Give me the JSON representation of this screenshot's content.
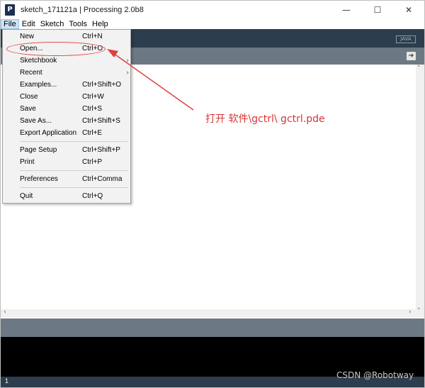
{
  "window": {
    "title": "sketch_171121a | Processing 2.0b8",
    "app_logo": "P",
    "controls": {
      "minimize": "—",
      "maximize": "☐",
      "close": "✕"
    }
  },
  "menubar": {
    "items": [
      {
        "label": "File",
        "active": true
      },
      {
        "label": "Edit"
      },
      {
        "label": "Sketch"
      },
      {
        "label": "Tools"
      },
      {
        "label": "Help"
      }
    ]
  },
  "toolbar": {
    "mode": "JAVA"
  },
  "tabstrip": {
    "arrow": "➔"
  },
  "file_menu": {
    "items": [
      {
        "label": "New",
        "shortcut": "Ctrl+N"
      },
      {
        "label": "Open...",
        "shortcut": "Ctrl+O"
      },
      {
        "label": "Sketchbook",
        "shortcut": "",
        "submenu": "›"
      },
      {
        "label": "Recent",
        "shortcut": "",
        "submenu": "›"
      },
      {
        "label": "Examples...",
        "shortcut": "Ctrl+Shift+O"
      },
      {
        "label": "Close",
        "shortcut": "Ctrl+W"
      },
      {
        "label": "Save",
        "shortcut": "Ctrl+S"
      },
      {
        "label": "Save As...",
        "shortcut": "Ctrl+Shift+S"
      },
      {
        "label": "Export Application",
        "shortcut": "Ctrl+E"
      },
      {
        "label": "Page Setup",
        "shortcut": "Ctrl+Shift+P"
      },
      {
        "label": "Print",
        "shortcut": "Ctrl+P"
      },
      {
        "label": "Preferences",
        "shortcut": "Ctrl+Comma"
      },
      {
        "label": "Quit",
        "shortcut": "Ctrl+Q"
      }
    ]
  },
  "editor": {
    "scroll_up": "˄",
    "scroll_down": "˅",
    "scroll_left": "‹",
    "scroll_right": "›"
  },
  "line_bar": {
    "line_number": "1"
  },
  "annotation": {
    "text": "打开 软件\\gctrl\\ gctrl.pde",
    "color": "#d93535"
  },
  "watermark": "CSDN @Robotway",
  "colors": {
    "toolbar": "#2c3d4d",
    "tabstrip": "#6c7884",
    "console": "#000000",
    "menu_highlight": "#cce4f7"
  }
}
